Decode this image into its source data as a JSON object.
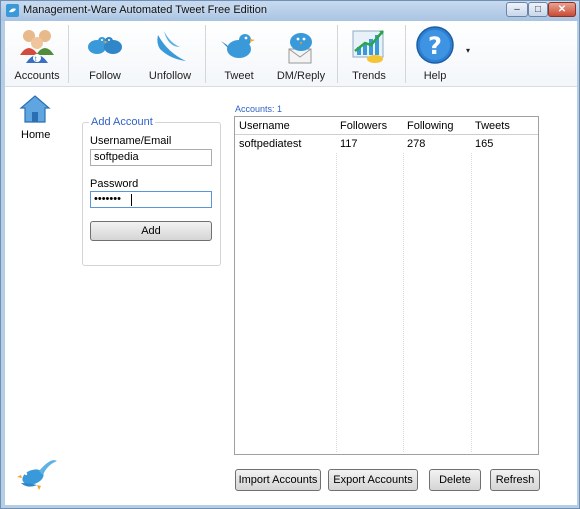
{
  "window": {
    "title": "Management-Ware Automated Tweet Free Edition",
    "controls": {
      "minimize": "–",
      "maximize": "□",
      "close": "✕"
    }
  },
  "toolbar": {
    "items": [
      {
        "label": "Accounts",
        "icon": "users-icon"
      },
      {
        "label": "Follow",
        "icon": "birds-icon"
      },
      {
        "label": "Unfollow",
        "icon": "bird-flying-icon"
      },
      {
        "label": "Tweet",
        "icon": "bird-tweet-icon"
      },
      {
        "label": "DM/Reply",
        "icon": "bird-mail-icon"
      },
      {
        "label": "Trends",
        "icon": "chart-trend-icon"
      },
      {
        "label": "Help",
        "icon": "help-icon"
      }
    ],
    "help_dropdown": "▾"
  },
  "sidebar": {
    "home_label": "Home"
  },
  "add_account": {
    "title": "Add Account",
    "username_label": "Username/Email",
    "username_value": "softpedia",
    "password_label": "Password",
    "password_value": "•••••••",
    "add_button": "Add"
  },
  "accounts": {
    "count_label": "Accounts: 1",
    "columns": [
      "Username",
      "Followers",
      "Following",
      "Tweets"
    ],
    "rows": [
      [
        "softpediatest",
        "117",
        "278",
        "165"
      ]
    ]
  },
  "buttons": {
    "import": "Import Accounts",
    "export": "Export Accounts",
    "delete": "Delete",
    "refresh": "Refresh"
  },
  "colors": {
    "accent": "#2f62c8",
    "title_bar": "#b6cde6",
    "bird_blue": "#3a9ad9"
  }
}
